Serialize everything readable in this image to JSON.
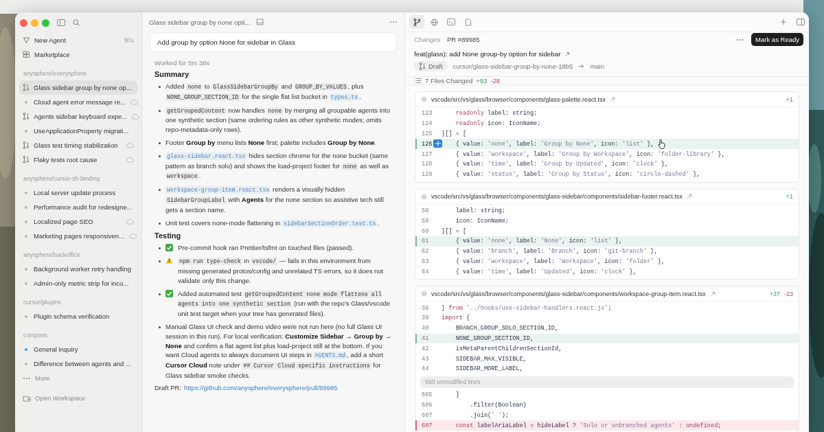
{
  "sidebar": {
    "new_agent": {
      "label": "New Agent",
      "shortcut": "⌘N"
    },
    "marketplace": {
      "label": "Marketplace"
    },
    "groups": [
      {
        "name": "anysphere/everysphere",
        "items": [
          {
            "title": "Glass sidebar group by none op...",
            "kind": "pr",
            "cloud": false,
            "unread": false,
            "selected": true
          },
          {
            "title": "Cloud agent error message re...",
            "kind": "chat",
            "cloud": true,
            "unread": false,
            "selected": false
          },
          {
            "title": "Agents sidebar keyboard expe...",
            "kind": "pr",
            "cloud": true,
            "unread": false,
            "selected": false
          },
          {
            "title": "UseApplicationProperty migrati...",
            "kind": "chat",
            "cloud": false,
            "unread": false,
            "selected": false
          },
          {
            "title": "Glass test timing stabilization",
            "kind": "pr",
            "cloud": true,
            "unread": false,
            "selected": false
          },
          {
            "title": "Flaky tests root cause",
            "kind": "pr",
            "cloud": true,
            "unread": false,
            "selected": false
          }
        ]
      },
      {
        "name": "anysphere/cursor-sh-landing",
        "items": [
          {
            "title": "Local server update process",
            "kind": "chat",
            "cloud": false,
            "unread": false,
            "selected": false
          },
          {
            "title": "Performance audit for redesigne...",
            "kind": "chat",
            "cloud": false,
            "unread": false,
            "selected": false
          },
          {
            "title": "Localized page SEO",
            "kind": "chat",
            "cloud": true,
            "unread": false,
            "selected": false
          },
          {
            "title": "Marketing pages responsiven...",
            "kind": "chat",
            "cloud": true,
            "unread": false,
            "selected": false
          }
        ]
      },
      {
        "name": "anysphere/backoffice",
        "items": [
          {
            "title": "Background worker retry handling",
            "kind": "chat",
            "cloud": false,
            "unread": false,
            "selected": false
          },
          {
            "title": "Admin-only metric strip for inco...",
            "kind": "chat",
            "cloud": false,
            "unread": false,
            "selected": false
          }
        ]
      },
      {
        "name": "cursor/plugins",
        "items": [
          {
            "title": "Plugin schema verification",
            "kind": "chat",
            "cloud": false,
            "unread": false,
            "selected": false
          }
        ]
      },
      {
        "name": "compass",
        "items": [
          {
            "title": "General inquiry",
            "kind": "chat",
            "cloud": false,
            "unread": true,
            "selected": false
          },
          {
            "title": "Difference between agents and ...",
            "kind": "chat",
            "cloud": false,
            "unread": false,
            "selected": false
          }
        ]
      }
    ],
    "more": "More",
    "open_workspace": "Open Workspace"
  },
  "chat": {
    "title": "Glass sidebar group by none opti...",
    "prompt": "Add group by option None for sidebar in Glass",
    "worked": "Worked for 5m 38s",
    "sections": [
      {
        "heading": "Summary",
        "bullets": [
          {
            "kind": "plain",
            "parts": [
              {
                "kind": "text",
                "text": "Added "
              },
              {
                "kind": "code",
                "text": "none"
              },
              {
                "kind": "text",
                "text": " to "
              },
              {
                "kind": "code",
                "text": "GlassSidebarGroupBy"
              },
              {
                "kind": "text",
                "text": " and "
              },
              {
                "kind": "code",
                "text": "GROUP_BY_VALUES"
              },
              {
                "kind": "text",
                "text": ", plus "
              },
              {
                "kind": "code",
                "text": "NONE_GROUP_SECTION_ID"
              },
              {
                "kind": "text",
                "text": " for the single flat list bucket in "
              },
              {
                "kind": "file",
                "text": "types.ts"
              },
              {
                "kind": "text",
                "text": "."
              }
            ]
          },
          {
            "kind": "plain",
            "parts": [
              {
                "kind": "code",
                "text": "getGroupedContent"
              },
              {
                "kind": "text",
                "text": " now handles "
              },
              {
                "kind": "code",
                "text": "none"
              },
              {
                "kind": "text",
                "text": " by merging all groupable agents into one synthetic section (same ordering rules as other synthetic modes; omits repo-metadata-only rows)."
              }
            ]
          },
          {
            "kind": "plain",
            "parts": [
              {
                "kind": "text",
                "text": "Footer "
              },
              {
                "kind": "bold",
                "text": "Group by"
              },
              {
                "kind": "text",
                "text": " menu lists "
              },
              {
                "kind": "bold",
                "text": "None"
              },
              {
                "kind": "text",
                "text": " first; palette includes "
              },
              {
                "kind": "bold",
                "text": "Group by None"
              },
              {
                "kind": "text",
                "text": "."
              }
            ]
          },
          {
            "kind": "plain",
            "parts": [
              {
                "kind": "file",
                "text": "glass-sidebar.react.tsx"
              },
              {
                "kind": "text",
                "text": " hides section chrome for the none bucket (same pattern as branch solo) and shows the load-project footer for "
              },
              {
                "kind": "code",
                "text": "none"
              },
              {
                "kind": "text",
                "text": " as well as "
              },
              {
                "kind": "code",
                "text": "workspace"
              },
              {
                "kind": "text",
                "text": "."
              }
            ]
          },
          {
            "kind": "plain",
            "parts": [
              {
                "kind": "file",
                "text": "workspace-group-item.react.tsx"
              },
              {
                "kind": "text",
                "text": " renders a visually hidden "
              },
              {
                "kind": "code",
                "text": "SidebarGroupLabel"
              },
              {
                "kind": "text",
                "text": " with "
              },
              {
                "kind": "bold",
                "text": "Agents"
              },
              {
                "kind": "text",
                "text": " for the none section so assistive tech still gets a section name."
              }
            ]
          },
          {
            "kind": "plain",
            "parts": [
              {
                "kind": "text",
                "text": "Unit test covers none-mode flattening in "
              },
              {
                "kind": "file",
                "text": "sidebarSectionOrder.test.ts"
              },
              {
                "kind": "text",
                "text": "."
              }
            ]
          }
        ]
      },
      {
        "heading": "Testing",
        "bullets": [
          {
            "kind": "check",
            "parts": [
              {
                "kind": "text",
                "text": "Pre-commit hook ran Prettier/tsfmt on touched files (passed)."
              }
            ]
          },
          {
            "kind": "warning",
            "parts": [
              {
                "kind": "code",
                "text": "npm run type-check"
              },
              {
                "kind": "text",
                "text": " in "
              },
              {
                "kind": "code",
                "text": "vscode/"
              },
              {
                "kind": "text",
                "text": " — fails in this environment from missing generated protos/config and unrelated TS errors, so it does not validate only this change."
              }
            ]
          },
          {
            "kind": "check",
            "parts": [
              {
                "kind": "text",
                "text": "Added automated test "
              },
              {
                "kind": "code",
                "text": "getGroupedContent none mode flattens all agents into one synthetic section"
              },
              {
                "kind": "text",
                "text": " (run with the repo's Glass/vscode unit test target when your tree has generated files)."
              }
            ]
          },
          {
            "kind": "plain",
            "parts": [
              {
                "kind": "text",
                "text": "Manual Glass UI check and demo video were not run here (no full Glass UI session in this run). For local verification: "
              },
              {
                "kind": "bold",
                "text": "Customize Sidebar → Group by → None"
              },
              {
                "kind": "text",
                "text": " and confirm a flat agent list plus load-project still at the bottom. If you want Cloud agents to always document UI steps in "
              },
              {
                "kind": "file",
                "text": "AGENTS.md"
              },
              {
                "kind": "text",
                "text": ", add a short "
              },
              {
                "kind": "bold",
                "text": "Cursor Cloud"
              },
              {
                "kind": "text",
                "text": " note under "
              },
              {
                "kind": "code",
                "text": "## Cursor Cloud specific instructions"
              },
              {
                "kind": "text",
                "text": " for Glass sidebar smoke checks."
              }
            ]
          }
        ]
      }
    ],
    "draft_pr": {
      "label": "Draft PR:",
      "url": "https://github.com/anysphere/everysphere/pull/89985"
    }
  },
  "changes_panel": {
    "toolbar": {
      "tabs": [
        {
          "kind": "changes",
          "selected": true
        },
        {
          "kind": "browser",
          "selected": false
        },
        {
          "kind": "terminal",
          "selected": false
        },
        {
          "kind": "file",
          "selected": false
        }
      ]
    },
    "header": {
      "section": "Changes",
      "pr_number": "PR #89985",
      "action": "Mark as Ready"
    },
    "title": "feat(glass): add None group-by option for sidebar",
    "status": "Draft",
    "branch": "cursor/glass-sidebar-group-by-none-18b5",
    "base": "main",
    "summary": {
      "files": "7 Files Changed",
      "additions": "+93",
      "deletions": "-28"
    },
    "files": [
      {
        "path": "vscode/src/vs/glass/browser/components/glass-palette.react.tsx",
        "additions": "+1",
        "lines": [
          {
            "kind": "line",
            "number": "123",
            "code": "    readonly label: string;",
            "added": false,
            "removed": false,
            "hovered": false
          },
          {
            "kind": "line",
            "number": "124",
            "code": "    readonly icon: IconName;",
            "added": false,
            "removed": false,
            "hovered": false
          },
          {
            "kind": "line",
            "number": "125",
            "code": "}[] = [",
            "added": false,
            "removed": false,
            "hovered": false
          },
          {
            "kind": "line",
            "number": "126",
            "code": "    { value: 'none', label: 'Group by None', icon: 'list' },",
            "added": true,
            "removed": false,
            "hovered": true
          },
          {
            "kind": "line",
            "number": "127",
            "code": "    { value: 'workspace', label: 'Group by Workspace', icon: 'folder-library' },",
            "added": false,
            "removed": false,
            "hovered": false
          },
          {
            "kind": "line",
            "number": "128",
            "code": "    { value: 'time', label: 'Group by Updated', icon: 'clock' },",
            "added": false,
            "removed": false,
            "hovered": false
          },
          {
            "kind": "line",
            "number": "129",
            "code": "    { value: 'status', label: 'Group by Status', icon: 'circle-dashed' },",
            "added": false,
            "removed": false,
            "hovered": false
          }
        ]
      },
      {
        "path": "vscode/src/vs/glass/browser/components/glass-sidebar/components/sidebar-footer.react.tsx",
        "additions": "+1",
        "lines": [
          {
            "kind": "line",
            "number": "58",
            "code": "    label: string;",
            "added": false,
            "removed": false,
            "hovered": false
          },
          {
            "kind": "line",
            "number": "59",
            "code": "    icon: IconName;",
            "added": false,
            "removed": false,
            "hovered": false
          },
          {
            "kind": "line",
            "number": "60",
            "code": "}[] = [",
            "added": false,
            "removed": false,
            "hovered": false
          },
          {
            "kind": "line",
            "number": "61",
            "code": "    { value: 'none', label: 'None', icon: 'list' },",
            "added": true,
            "removed": false,
            "hovered": false
          },
          {
            "kind": "line",
            "number": "62",
            "code": "    { value: 'branch', label: 'Branch', icon: 'git-branch' },",
            "added": false,
            "removed": false,
            "hovered": false
          },
          {
            "kind": "line",
            "number": "63",
            "code": "    { value: 'workspace', label: 'Workspace', icon: 'folder' },",
            "added": false,
            "removed": false,
            "hovered": false
          },
          {
            "kind": "line",
            "number": "64",
            "code": "    { value: 'time', label: 'Updated', icon: 'clock' },",
            "added": false,
            "removed": false,
            "hovered": false
          }
        ]
      },
      {
        "path": "vscode/src/vs/glass/browser/components/glass-sidebar/components/workspace-group-item.react.tsx",
        "additions": "+37",
        "deletions": "-23",
        "lines": [
          {
            "kind": "line",
            "number": "38",
            "code": "} from '../hooks/use-sidebar-handlers.react.js';",
            "added": false,
            "removed": false,
            "hovered": false
          },
          {
            "kind": "line",
            "number": "39",
            "code": "import {",
            "added": false,
            "removed": false,
            "hovered": false
          },
          {
            "kind": "line",
            "number": "40",
            "code": "    BRANCH_GROUP_SOLO_SECTION_ID,",
            "added": false,
            "removed": false,
            "hovered": false
          },
          {
            "kind": "line",
            "number": "41",
            "code": "    NONE_GROUP_SECTION_ID,",
            "added": true,
            "removed": false,
            "hovered": false
          },
          {
            "kind": "line",
            "number": "42",
            "code": "    isMetaParentChildrenSectionId,",
            "added": false,
            "removed": false,
            "hovered": false
          },
          {
            "kind": "line",
            "number": "43",
            "code": "    SIDEBAR_MAX_VISIBLE,",
            "added": false,
            "removed": false,
            "hovered": false
          },
          {
            "kind": "line",
            "number": "44",
            "code": "    SIDEBAR_MORE_LABEL,",
            "added": false,
            "removed": false,
            "hovered": false
          },
          {
            "kind": "gap",
            "text": "560 unmodified lines"
          },
          {
            "kind": "line",
            "number": "605",
            "code": "    ]",
            "added": false,
            "removed": false,
            "hovered": false
          },
          {
            "kind": "line",
            "number": "606",
            "code": "        .filter(Boolean)",
            "added": false,
            "removed": false,
            "hovered": false
          },
          {
            "kind": "line",
            "number": "607",
            "code": "        .join(' ');",
            "added": false,
            "removed": false,
            "hovered": false
          },
          {
            "kind": "line",
            "number": "607",
            "code": "    const labelAriaLabel = hideLabel ? 'Solo or unbranched agents' : undefined;",
            "added": false,
            "removed": true,
            "hovered": false
          }
        ]
      }
    ]
  }
}
